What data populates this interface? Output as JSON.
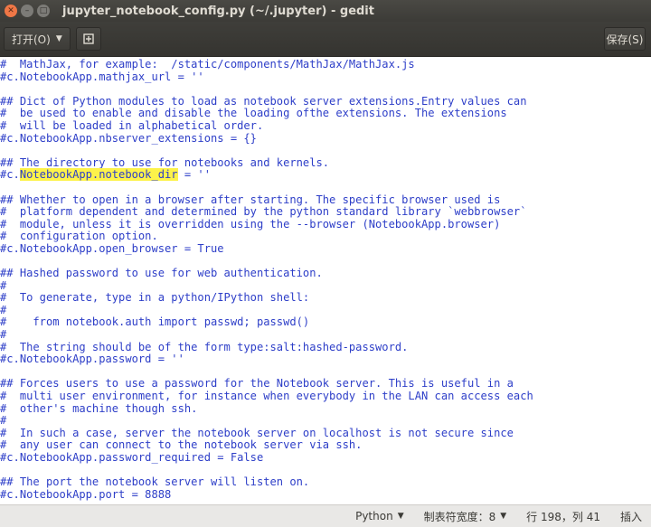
{
  "window": {
    "title": "jupyter_notebook_config.py (~/.jupyter) - gedit"
  },
  "toolbar": {
    "open_label": "打开(O)",
    "save_label": "保存(S)"
  },
  "editor": {
    "lines": [
      "#  MathJax, for example:  /static/components/MathJax/MathJax.js",
      "#c.NotebookApp.mathjax_url = ''",
      "",
      "## Dict of Python modules to load as notebook server extensions.Entry values can",
      "#  be used to enable and disable the loading ofthe extensions. The extensions",
      "#  will be loaded in alphabetical order.",
      "#c.NotebookApp.nbserver_extensions = {}",
      "",
      "## The directory to use for notebooks and kernels.",
      "#c.NotebookApp.notebook_dir = ''",
      "",
      "## Whether to open in a browser after starting. The specific browser used is",
      "#  platform dependent and determined by the python standard library `webbrowser`",
      "#  module, unless it is overridden using the --browser (NotebookApp.browser)",
      "#  configuration option.",
      "#c.NotebookApp.open_browser = True",
      "",
      "## Hashed password to use for web authentication.",
      "#",
      "#  To generate, type in a python/IPython shell:",
      "#",
      "#    from notebook.auth import passwd; passwd()",
      "#",
      "#  The string should be of the form type:salt:hashed-password.",
      "#c.NotebookApp.password = ''",
      "",
      "## Forces users to use a password for the Notebook server. This is useful in a",
      "#  multi user environment, for instance when everybody in the LAN can access each",
      "#  other's machine though ssh.",
      "#",
      "#  In such a case, server the notebook server on localhost is not secure since",
      "#  any user can connect to the notebook server via ssh.",
      "#c.NotebookApp.password_required = False",
      "",
      "## The port the notebook server will listen on.",
      "#c.NotebookApp.port = 8888"
    ],
    "highlight_text": "NotebookApp.notebook_dir"
  },
  "statusbar": {
    "language": "Python",
    "tab_width": "制表符宽度：8",
    "position": "行 198，列 41",
    "mode": "插入"
  }
}
